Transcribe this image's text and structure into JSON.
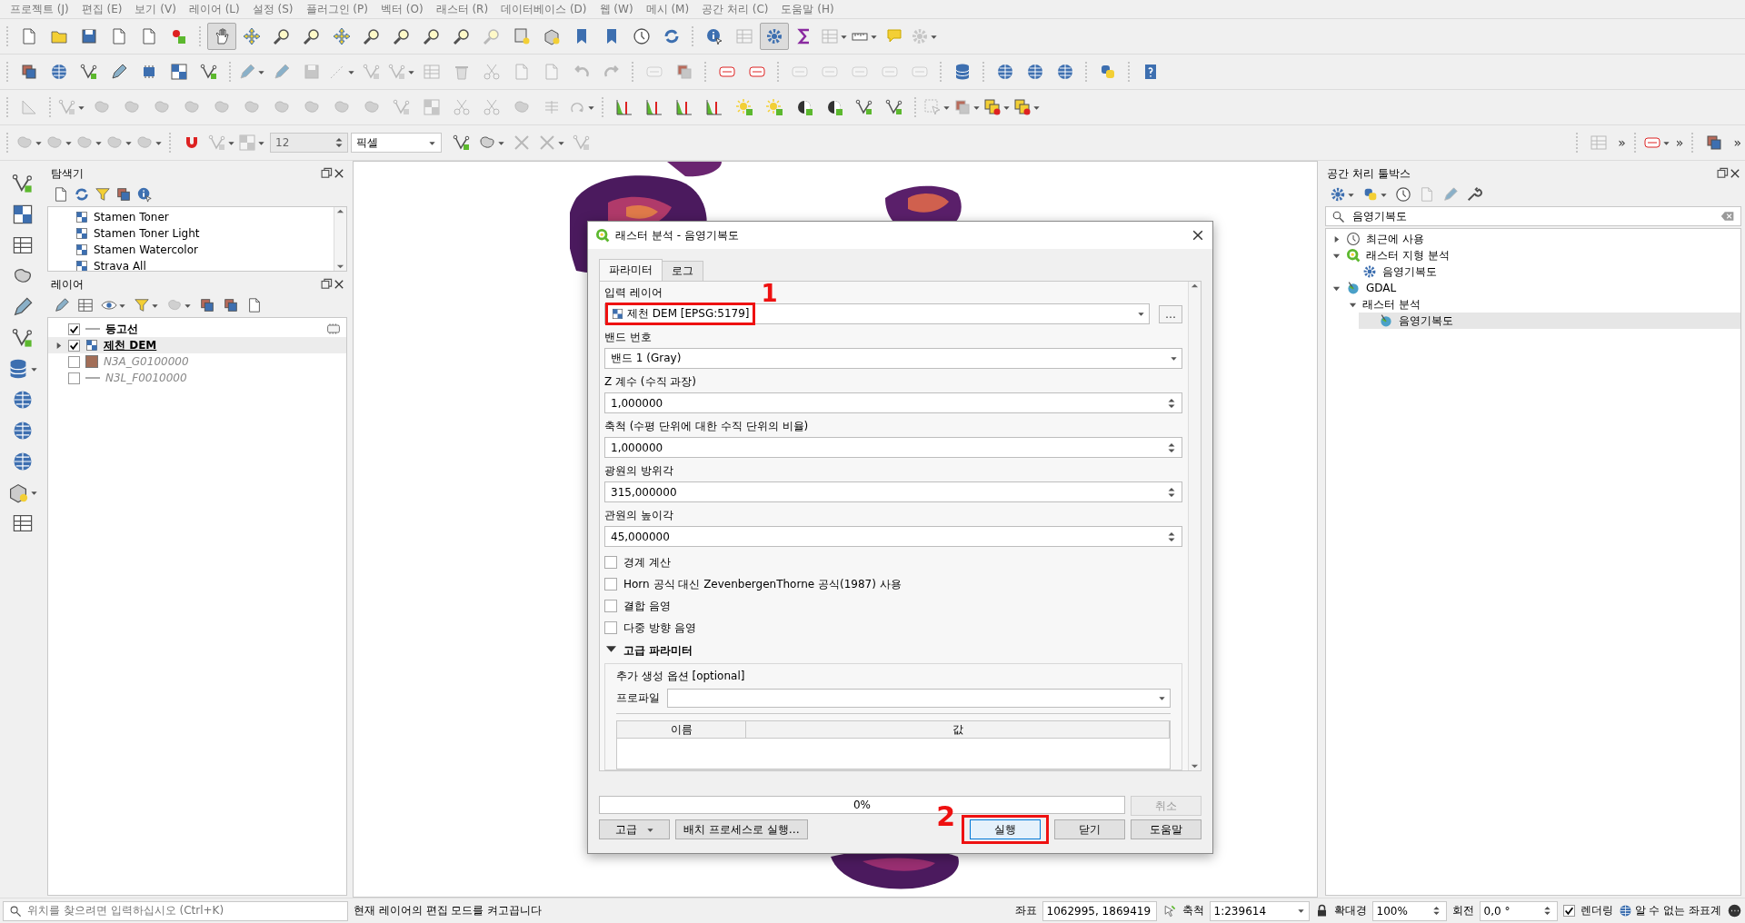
{
  "menu": [
    "프로젝트 (J)",
    "편집 (E)",
    "보기 (V)",
    "레이어 (L)",
    "설정 (S)",
    "플러그인 (P)",
    "벡터 (O)",
    "래스터 (R)",
    "데이터베이스 (D)",
    "웹 (W)",
    "메시 (M)",
    "공간 처리 (C)",
    "도움말 (H)"
  ],
  "toolbars": [
    {
      "buttons": [
        {
          "disabled": false,
          "selected": false
        },
        {
          "disabled": false,
          "selected": false
        },
        {
          "disabled": false,
          "selected": false
        },
        {
          "disabled": false,
          "selected": false
        },
        {
          "disabled": false,
          "selected": false
        },
        {
          "disabled": false,
          "selected": false
        },
        {
          "disabled": false,
          "selected": true
        },
        {
          "disabled": false,
          "selected": false
        },
        {
          "disabled": false,
          "selected": false
        },
        {
          "disabled": false,
          "selected": false
        },
        {
          "disabled": false,
          "selected": false
        },
        {
          "disabled": false,
          "selected": false
        },
        {
          "disabled": false,
          "selected": false
        },
        {
          "disabled": false,
          "selected": false
        },
        {
          "disabled": false,
          "selected": false
        },
        {
          "disabled": true,
          "selected": false
        },
        {
          "disabled": false,
          "selected": false
        },
        {
          "disabled": false,
          "selected": false
        },
        {
          "disabled": false,
          "selected": false
        },
        {
          "disabled": false,
          "selected": false
        },
        {
          "disabled": false,
          "selected": false
        },
        {
          "disabled": false,
          "selected": false
        },
        {
          "disabled": false,
          "selected": false
        },
        {
          "disabled": true,
          "selected": false
        },
        {
          "disabled": false,
          "selected": true
        },
        {
          "disabled": false,
          "selected": false
        },
        {
          "disabled": true,
          "selected": false
        },
        {
          "disabled": false,
          "selected": false
        },
        {
          "disabled": false,
          "selected": false
        },
        {
          "disabled": true,
          "selected": false
        }
      ]
    },
    {
      "buttons": [
        {
          "disabled": false,
          "selected": false
        },
        {
          "disabled": false,
          "selected": false
        },
        {
          "disabled": false,
          "selected": false
        },
        {
          "disabled": false,
          "selected": false
        },
        {
          "disabled": false,
          "selected": false
        },
        {
          "disabled": false,
          "selected": false
        },
        {
          "disabled": false,
          "selected": false
        },
        {
          "disabled": true,
          "selected": false
        },
        {
          "disabled": true,
          "selected": false
        },
        {
          "disabled": true,
          "selected": false
        },
        {
          "disabled": true,
          "selected": false
        },
        {
          "disabled": true,
          "selected": false
        },
        {
          "disabled": true,
          "selected": false
        },
        {
          "disabled": true,
          "selected": false
        },
        {
          "disabled": true,
          "selected": false
        },
        {
          "disabled": true,
          "selected": false
        },
        {
          "disabled": true,
          "selected": false
        },
        {
          "disabled": true,
          "selected": false
        },
        {
          "disabled": true,
          "selected": false
        },
        {
          "disabled": true,
          "selected": false
        },
        {
          "disabled": true,
          "selected": false
        },
        {
          "disabled": true,
          "selected": false
        },
        {
          "disabled": false,
          "selected": false
        },
        {
          "disabled": false,
          "selected": false
        },
        {
          "disabled": true,
          "selected": false
        },
        {
          "disabled": true,
          "selected": false
        },
        {
          "disabled": true,
          "selected": false
        },
        {
          "disabled": true,
          "selected": false
        },
        {
          "disabled": true,
          "selected": false
        },
        {
          "disabled": false,
          "selected": false
        },
        {
          "disabled": false,
          "selected": false
        },
        {
          "disabled": false,
          "selected": false
        },
        {
          "disabled": false,
          "selected": false
        },
        {
          "disabled": false,
          "selected": false
        },
        {
          "disabled": false,
          "selected": false
        }
      ]
    },
    {
      "buttons": [
        {
          "disabled": true,
          "selected": false
        },
        {
          "disabled": true,
          "selected": false
        },
        {
          "disabled": true,
          "selected": false
        },
        {
          "disabled": true,
          "selected": false
        },
        {
          "disabled": true,
          "selected": false
        },
        {
          "disabled": true,
          "selected": false
        },
        {
          "disabled": true,
          "selected": false
        },
        {
          "disabled": true,
          "selected": false
        },
        {
          "disabled": true,
          "selected": false
        },
        {
          "disabled": true,
          "selected": false
        },
        {
          "disabled": true,
          "selected": false
        },
        {
          "disabled": true,
          "selected": false
        },
        {
          "disabled": true,
          "selected": false
        },
        {
          "disabled": true,
          "selected": false
        },
        {
          "disabled": true,
          "selected": false
        },
        {
          "disabled": true,
          "selected": false
        },
        {
          "disabled": true,
          "selected": false
        },
        {
          "disabled": true,
          "selected": false
        },
        {
          "disabled": true,
          "selected": false
        },
        {
          "disabled": false,
          "selected": false
        },
        {
          "disabled": false,
          "selected": false
        },
        {
          "disabled": false,
          "selected": false
        },
        {
          "disabled": false,
          "selected": false
        },
        {
          "disabled": false,
          "selected": false
        },
        {
          "disabled": false,
          "selected": false
        },
        {
          "disabled": false,
          "selected": false
        },
        {
          "disabled": false,
          "selected": false
        },
        {
          "disabled": false,
          "selected": false
        },
        {
          "disabled": false,
          "selected": false
        },
        {
          "disabled": true,
          "selected": false
        },
        {
          "disabled": true,
          "selected": false
        },
        {
          "disabled": false,
          "selected": false
        },
        {
          "disabled": false,
          "selected": false
        }
      ]
    },
    {
      "buttons": [
        {
          "disabled": true,
          "selected": false
        },
        {
          "disabled": true,
          "selected": false
        },
        {
          "disabled": true,
          "selected": false
        },
        {
          "disabled": true,
          "selected": false
        },
        {
          "disabled": true,
          "selected": false
        },
        {
          "disabled": false,
          "selected": false
        },
        {
          "disabled": true,
          "selected": false
        },
        {
          "disabled": true,
          "selected": false
        },
        {
          "disabled": false,
          "selected": false
        },
        {
          "disabled": false,
          "selected": false
        },
        {
          "disabled": true,
          "selected": false
        },
        {
          "disabled": true,
          "selected": false
        },
        {
          "disabled": true,
          "selected": false
        },
        {
          "disabled": true,
          "selected": false
        },
        {
          "disabled": false,
          "selected": false
        },
        {
          "disabled": false,
          "selected": false
        }
      ],
      "tolerance": "12",
      "unit": "픽셀",
      "overflow": [
        "»",
        "»",
        "»"
      ]
    }
  ],
  "left_toolbar": {
    "buttons": [
      {
        "disabled": false
      },
      {
        "disabled": false
      },
      {
        "disabled": false
      },
      {
        "disabled": false
      },
      {
        "disabled": false
      },
      {
        "disabled": false
      },
      {
        "disabled": false
      },
      {
        "disabled": false
      },
      {
        "disabled": false
      },
      {
        "disabled": false
      },
      {
        "disabled": false
      },
      {
        "disabled": false
      }
    ]
  },
  "browser": {
    "title": "탐색기",
    "items": [
      "Stamen Toner",
      "Stamen Toner Light",
      "Stamen Watercolor",
      "Strava All"
    ]
  },
  "layers": {
    "title": "레이어",
    "tools": [
      {
        "disabled": false
      },
      {
        "disabled": false
      },
      {
        "disabled": false
      },
      {
        "disabled": false
      },
      {
        "disabled": true
      },
      {
        "disabled": false
      },
      {
        "disabled": false
      },
      {
        "disabled": false
      }
    ],
    "items": [
      {
        "name": "등고선",
        "kind": "line",
        "checked": true,
        "selected": false,
        "indicator": true
      },
      {
        "name": "제천 DEM",
        "kind": "raster",
        "checked": true,
        "selected": true,
        "expanded": false,
        "indicator": false
      },
      {
        "name": "N3A_G0100000",
        "kind": "polygon",
        "color": "#a26e58",
        "checked": false,
        "selected": false,
        "indicator": false
      },
      {
        "name": "N3L_F0010000",
        "kind": "line",
        "checked": false,
        "selected": false,
        "indicator": false
      }
    ]
  },
  "dialog": {
    "title": "래스터 분석 - 음영기복도",
    "tabs": [
      {
        "label": "파라미터",
        "selected": true
      },
      {
        "label": "로그",
        "selected": false
      }
    ],
    "parameters": [
      {
        "kind": "layer",
        "label": "입력 레이어",
        "value": "제천 DEM [EPSG:5179]",
        "browse": "…",
        "highlighted": true,
        "marker": "1"
      },
      {
        "kind": "combo",
        "label": "밴드 번호",
        "value": "밴드 1 (Gray)"
      },
      {
        "kind": "number",
        "label": "Z 계수 (수직 과장)",
        "value": "1,000000"
      },
      {
        "kind": "number",
        "label": "축척 (수평 단위에 대한 수직 단위의 비율)",
        "value": "1,000000"
      },
      {
        "kind": "number",
        "label": "광원의 방위각",
        "value": "315,000000"
      },
      {
        "kind": "number",
        "label": "관원의 높이각",
        "value": "45,000000"
      },
      {
        "kind": "checkbox",
        "label": "경계 계산",
        "checked": false
      },
      {
        "kind": "checkbox",
        "label": "Horn 공식 대신 ZevenbergenThorne 공식(1987) 사용",
        "checked": false
      },
      {
        "kind": "checkbox",
        "label": "결합 음영",
        "checked": false
      },
      {
        "kind": "checkbox",
        "label": "다중 방향 음영",
        "checked": false
      }
    ],
    "advanced": {
      "label": "고급 파라미터",
      "expanded": true,
      "options_label": "추가 생성 옵션 [optional]",
      "profile_label": "프로파일",
      "columns": [
        "이름",
        "값"
      ]
    },
    "progress": {
      "level": 0,
      "text": "0%",
      "cancel": {
        "label": "취소",
        "disabled": true
      }
    },
    "buttons": [
      {
        "kind": "menu",
        "label": "고급",
        "disabled": false
      },
      {
        "kind": "plain",
        "label": "배치 프로세스로 실행…",
        "disabled": false
      },
      {
        "kind": "run",
        "label": "실행",
        "disabled": false,
        "highlighted": true,
        "marker": "2"
      },
      {
        "kind": "close",
        "label": "닫기",
        "disabled": false
      },
      {
        "kind": "help",
        "label": "도움말",
        "disabled": false
      }
    ]
  },
  "toolbox": {
    "title": "공간 처리 툴박스",
    "tools": [
      {
        "disabled": false
      },
      {
        "disabled": false
      },
      {
        "disabled": false
      },
      {
        "disabled": true
      },
      {
        "disabled": true
      },
      {
        "disabled": false
      }
    ],
    "search": {
      "value": "음영기복도"
    },
    "tree": [
      {
        "label": "최근에 사용",
        "kind": "recent",
        "expanded": false,
        "selected": false
      },
      {
        "label": "래스터 지형 분석",
        "kind": "qgis",
        "expanded": true,
        "selected": false,
        "children": [
          {
            "label": "음영기복도",
            "kind": "algorithm",
            "selected": false
          }
        ]
      },
      {
        "label": "GDAL",
        "kind": "gdal",
        "expanded": true,
        "selected": false,
        "children": [
          {
            "label": "래스터 분석",
            "kind": "group",
            "expanded": true,
            "selected": false,
            "children": [
              {
                "label": "음영기복도",
                "kind": "gdal",
                "selected": true
              }
            ]
          }
        ]
      }
    ]
  },
  "status": {
    "search_placeholder": "위치를 찾으려면 입력하십시오 (Ctrl+K)",
    "message": "현재 레이어의 편집 모드를 켜고끕니다",
    "coordinate_label": "좌표",
    "coordinate": "1062995, 1869419",
    "scale_label": "축척",
    "scale": "1:239614",
    "magnifier_label": "확대경",
    "magnifier": "100%",
    "rotation_label": "회전",
    "rotation": "0,0 °",
    "render": {
      "label": "렌더링",
      "checked": true
    },
    "crs": "알 수 없는 좌표계"
  }
}
